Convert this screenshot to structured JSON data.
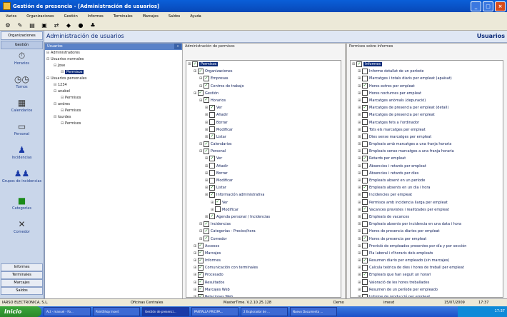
{
  "window": {
    "title": "Gestión de presencia - [Administración de usuarios]"
  },
  "menu": [
    "Varios",
    "Organizaciones",
    "Gestión",
    "Informes",
    "Terminales",
    "Marcajes",
    "Saldos",
    "Ayuda"
  ],
  "sidebar": {
    "tab_top": "Organizaciones",
    "tab_active": "Gestión",
    "items": [
      "Horarios",
      "Turnos",
      "Calendarios",
      "Personal",
      "Incidencias",
      "Grupos de incidencias",
      "Categorías",
      "Comedor"
    ],
    "bottom_tabs": [
      "Informes",
      "Terminales",
      "Marcajes",
      "Saldos"
    ]
  },
  "header": {
    "title": "Administración de usuarios",
    "right": "Usuarios"
  },
  "users_panel": {
    "title": "Usuarios",
    "tree": [
      {
        "indent": 0,
        "text": "Administradores"
      },
      {
        "indent": 0,
        "text": "Usuarios normales"
      },
      {
        "indent": 1,
        "text": "Jose"
      },
      {
        "indent": 2,
        "text": "Permisos",
        "selected": true
      },
      {
        "indent": 0,
        "text": "Usuarios personales"
      },
      {
        "indent": 1,
        "text": "1234"
      },
      {
        "indent": 1,
        "text": "anabel"
      },
      {
        "indent": 2,
        "text": "Permisos"
      },
      {
        "indent": 1,
        "text": "andres"
      },
      {
        "indent": 2,
        "text": "Permisos"
      },
      {
        "indent": 1,
        "text": "lourdes"
      },
      {
        "indent": 2,
        "text": "Permisos"
      }
    ]
  },
  "permissions": {
    "title": "Administración de permisos",
    "tree": [
      {
        "indent": 0,
        "text": "Permisos",
        "checked": true,
        "hl": true
      },
      {
        "indent": 1,
        "text": "Organizaciones",
        "checked": true
      },
      {
        "indent": 2,
        "text": "Empresas",
        "checked": true
      },
      {
        "indent": 2,
        "text": "Centros de trabajo",
        "checked": true
      },
      {
        "indent": 1,
        "text": "Gestión",
        "checked": true
      },
      {
        "indent": 2,
        "text": "Horarios",
        "checked": true
      },
      {
        "indent": 3,
        "text": "Ver",
        "checked": true
      },
      {
        "indent": 3,
        "text": "Añadir",
        "checked": false
      },
      {
        "indent": 3,
        "text": "Borrar",
        "checked": false
      },
      {
        "indent": 3,
        "text": "Modificar",
        "checked": false
      },
      {
        "indent": 3,
        "text": "Listar",
        "checked": true
      },
      {
        "indent": 2,
        "text": "Calendarios",
        "checked": true
      },
      {
        "indent": 2,
        "text": "Personal",
        "checked": true
      },
      {
        "indent": 3,
        "text": "Ver",
        "checked": true
      },
      {
        "indent": 3,
        "text": "Añadir",
        "checked": false
      },
      {
        "indent": 3,
        "text": "Borrar",
        "checked": false
      },
      {
        "indent": 3,
        "text": "Modificar",
        "checked": false
      },
      {
        "indent": 3,
        "text": "Listar",
        "checked": true
      },
      {
        "indent": 3,
        "text": "Información administrativa",
        "checked": true
      },
      {
        "indent": 4,
        "text": "Ver",
        "checked": true
      },
      {
        "indent": 4,
        "text": "Modificar",
        "checked": false
      },
      {
        "indent": 3,
        "text": "Agenda personal / Incidencias",
        "checked": true
      },
      {
        "indent": 2,
        "text": "Incidencias",
        "checked": true
      },
      {
        "indent": 2,
        "text": "Categorías - Precios/hora",
        "checked": true
      },
      {
        "indent": 2,
        "text": "Comedor",
        "checked": true
      },
      {
        "indent": 1,
        "text": "Accesos",
        "checked": true
      },
      {
        "indent": 1,
        "text": "Marcajes",
        "checked": true
      },
      {
        "indent": 1,
        "text": "Informes",
        "checked": true
      },
      {
        "indent": 1,
        "text": "Comunicación con terminales",
        "checked": true
      },
      {
        "indent": 1,
        "text": "Procesado",
        "checked": true
      },
      {
        "indent": 1,
        "text": "Resultados",
        "checked": true
      },
      {
        "indent": 1,
        "text": "Marcajes Web",
        "checked": true
      },
      {
        "indent": 1,
        "text": "Relaciones Web",
        "checked": true
      }
    ]
  },
  "reports": {
    "title": "Permisos sobre informes",
    "tree": [
      {
        "indent": 0,
        "text": "Informes",
        "checked": true,
        "hl": true
      },
      {
        "indent": 1,
        "text": "Informe detallat de un període",
        "checked": false
      },
      {
        "indent": 1,
        "text": "Marcatges i totals diaris per empleat (apaïsat)",
        "checked": false
      },
      {
        "indent": 1,
        "text": "Hores extres per empleat",
        "checked": true
      },
      {
        "indent": 1,
        "text": "Hores nocturnes per empleat",
        "checked": false
      },
      {
        "indent": 1,
        "text": "Marcatges anòmals (depuració)",
        "checked": false
      },
      {
        "indent": 1,
        "text": "Marcatges de presencia per empleat (detall)",
        "checked": true
      },
      {
        "indent": 1,
        "text": "Marcatges de presencia per empleat",
        "checked": false
      },
      {
        "indent": 1,
        "text": "Marcatges fets a l'ordinador",
        "checked": false
      },
      {
        "indent": 1,
        "text": "Tots els marcatges per empleat",
        "checked": false
      },
      {
        "indent": 1,
        "text": "Dies sense marcatges per empleat",
        "checked": false
      },
      {
        "indent": 1,
        "text": "Empleats amb marcatges a una franja horaria",
        "checked": false
      },
      {
        "indent": 1,
        "text": "Empleats sense marcatges a una franja horaria",
        "checked": false
      },
      {
        "indent": 1,
        "text": "Retards per empleat",
        "checked": true
      },
      {
        "indent": 1,
        "text": "Absencies i retards per empleat",
        "checked": false
      },
      {
        "indent": 1,
        "text": "Absencies i retards per dies",
        "checked": false
      },
      {
        "indent": 1,
        "text": "Empleats absent en un període",
        "checked": false
      },
      {
        "indent": 1,
        "text": "Empleats absents en un dia i hora",
        "checked": true
      },
      {
        "indent": 1,
        "text": "Incidencies per empleat",
        "checked": false
      },
      {
        "indent": 1,
        "text": "Permisos amb incidencia llarga per empleat",
        "checked": false
      },
      {
        "indent": 1,
        "text": "Vacances previstes i realitzades per empleat",
        "checked": true
      },
      {
        "indent": 1,
        "text": "Empleats de vacances",
        "checked": false
      },
      {
        "indent": 1,
        "text": "Empleats absents per incidencia en una data i hora",
        "checked": false
      },
      {
        "indent": 1,
        "text": "Hores de presencia diaries per empleat",
        "checked": false
      },
      {
        "indent": 1,
        "text": "Hores de presencia per empleat",
        "checked": true
      },
      {
        "indent": 1,
        "text": "Previsió de empleados presentes por día y por sección",
        "checked": false
      },
      {
        "indent": 1,
        "text": "Pla laboral i d'horaris dels empleats",
        "checked": false
      },
      {
        "indent": 1,
        "text": "Resumen diario per empleado (sin marcajes)",
        "checked": true
      },
      {
        "indent": 1,
        "text": "Calcula teòrica de dies i hores de treball per empleat",
        "checked": false
      },
      {
        "indent": 1,
        "text": "Empleats que han seguit un horari",
        "checked": true
      },
      {
        "indent": 1,
        "text": "Valoració de les hores treballades",
        "checked": false
      },
      {
        "indent": 1,
        "text": "Resumen de un període per empleado",
        "checked": false
      },
      {
        "indent": 1,
        "text": "Informe de producció per empleat",
        "checked": false
      },
      {
        "indent": 1,
        "text": "Informe de producció per empleat (apaïsat)",
        "checked": false
      }
    ]
  },
  "status": {
    "company": "IARSO ELECTRONICA, S.L.",
    "office": "Oficinas Centrales",
    "version": "MasterTime. V.2.10.25.128",
    "mode": "Demo",
    "user": "imesd",
    "date": "15/07/2009",
    "time": "17:37"
  },
  "taskbar": {
    "start": "Inicio",
    "tasks": [
      "Act - manuel - Fo...",
      "PaintShop Insert",
      "Gestión de presenci...",
      "PANTALLA PRICIPA...",
      "2 Explorador de ...",
      "Nuevo Documento ..."
    ],
    "clock": "17:37"
  }
}
